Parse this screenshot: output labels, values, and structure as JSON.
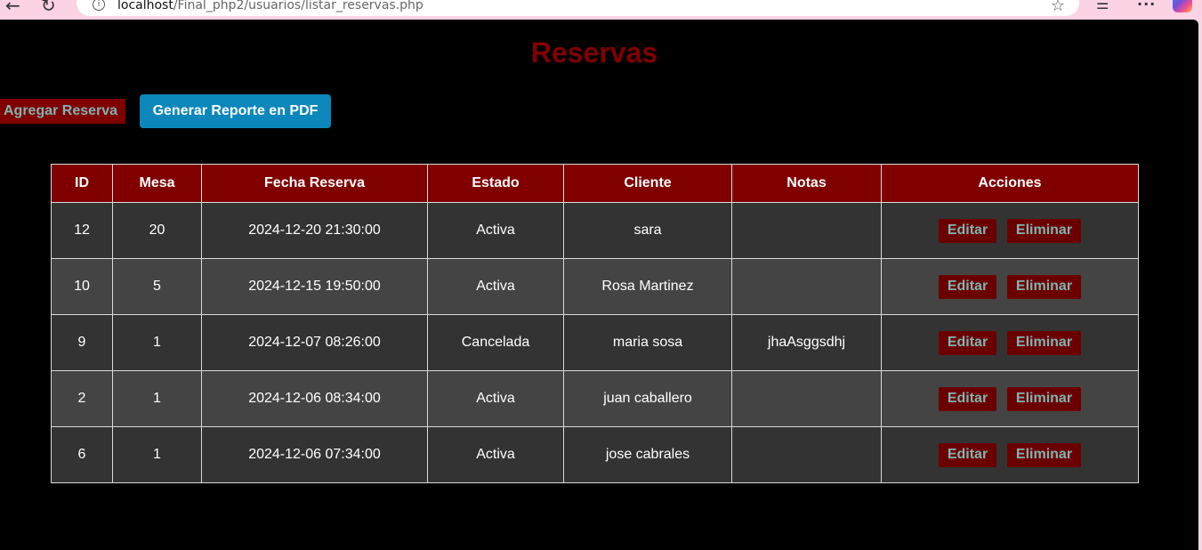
{
  "browser": {
    "url_host": "localhost",
    "url_path": "/Final_php2/usuarios/listar_reservas.php",
    "icons": [
      "back-icon",
      "reload-icon",
      "info-icon",
      "star-icon",
      "reader-icon",
      "more-icon",
      "copilot-icon"
    ]
  },
  "page": {
    "title": "Reservas",
    "add_button": "Agregar Reserva",
    "pdf_button": "Generar Reporte en PDF"
  },
  "table": {
    "headers": [
      "ID",
      "Mesa",
      "Fecha Reserva",
      "Estado",
      "Cliente",
      "Notas",
      "Acciones"
    ],
    "edit_label": "Editar",
    "delete_label": "Eliminar",
    "rows": [
      {
        "id": "12",
        "mesa": "20",
        "fecha": "2024-12-20 21:30:00",
        "estado": "Activa",
        "cliente": "sara",
        "notas": ""
      },
      {
        "id": "10",
        "mesa": "5",
        "fecha": "2024-12-15 19:50:00",
        "estado": "Activa",
        "cliente": "Rosa Martinez",
        "notas": ""
      },
      {
        "id": "9",
        "mesa": "1",
        "fecha": "2024-12-07 08:26:00",
        "estado": "Cancelada",
        "cliente": "maria sosa",
        "notas": "jhaAsggsdhj"
      },
      {
        "id": "2",
        "mesa": "1",
        "fecha": "2024-12-06 08:34:00",
        "estado": "Activa",
        "cliente": "juan caballero",
        "notas": ""
      },
      {
        "id": "6",
        "mesa": "1",
        "fecha": "2024-12-06 07:34:00",
        "estado": "Activa",
        "cliente": "jose cabrales",
        "notas": ""
      }
    ]
  },
  "colors": {
    "title": "#800000",
    "header_bg": "#800000",
    "button_text": "#7fb3b3",
    "pdf_button_bg": "#0b87bb",
    "row_odd": "#333333",
    "row_even": "#444444",
    "page_bg": "#000000",
    "browser_bg": "#fbd3e4"
  }
}
